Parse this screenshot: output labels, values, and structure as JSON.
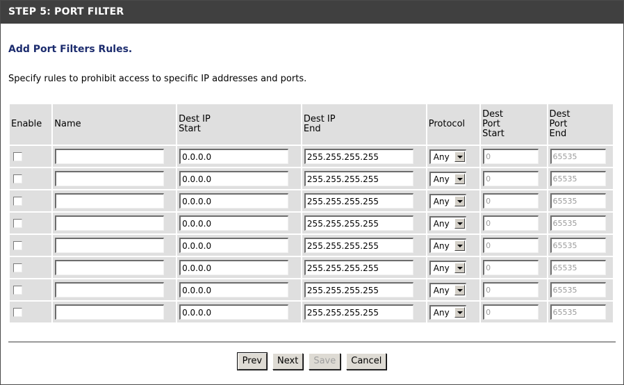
{
  "header": {
    "title": "STEP 5: PORT FILTER"
  },
  "subtitle": "Add Port Filters Rules.",
  "description": "Specify rules to prohibit access to specific IP addresses and ports.",
  "table": {
    "columns": {
      "enable": "Enable",
      "name": "Name",
      "dest_ip_start": [
        "Dest IP",
        "Start"
      ],
      "dest_ip_end": [
        "Dest IP",
        "End"
      ],
      "protocol": "Protocol",
      "dest_port_start": [
        "Dest",
        "Port",
        "Start"
      ],
      "dest_port_end": [
        "Dest",
        "Port",
        "End"
      ]
    },
    "rows": [
      {
        "enabled": false,
        "name": "",
        "ip_start": "0.0.0.0",
        "ip_end": "255.255.255.255",
        "protocol": "Any",
        "port_start": "0",
        "port_end": "65535"
      },
      {
        "enabled": false,
        "name": "",
        "ip_start": "0.0.0.0",
        "ip_end": "255.255.255.255",
        "protocol": "Any",
        "port_start": "0",
        "port_end": "65535"
      },
      {
        "enabled": false,
        "name": "",
        "ip_start": "0.0.0.0",
        "ip_end": "255.255.255.255",
        "protocol": "Any",
        "port_start": "0",
        "port_end": "65535"
      },
      {
        "enabled": false,
        "name": "",
        "ip_start": "0.0.0.0",
        "ip_end": "255.255.255.255",
        "protocol": "Any",
        "port_start": "0",
        "port_end": "65535"
      },
      {
        "enabled": false,
        "name": "",
        "ip_start": "0.0.0.0",
        "ip_end": "255.255.255.255",
        "protocol": "Any",
        "port_start": "0",
        "port_end": "65535"
      },
      {
        "enabled": false,
        "name": "",
        "ip_start": "0.0.0.0",
        "ip_end": "255.255.255.255",
        "protocol": "Any",
        "port_start": "0",
        "port_end": "65535"
      },
      {
        "enabled": false,
        "name": "",
        "ip_start": "0.0.0.0",
        "ip_end": "255.255.255.255",
        "protocol": "Any",
        "port_start": "0",
        "port_end": "65535"
      },
      {
        "enabled": false,
        "name": "",
        "ip_start": "0.0.0.0",
        "ip_end": "255.255.255.255",
        "protocol": "Any",
        "port_start": "0",
        "port_end": "65535"
      }
    ]
  },
  "buttons": {
    "prev": "Prev",
    "next": "Next",
    "save": "Save",
    "cancel": "Cancel"
  },
  "colors": {
    "header_bg": "#404040",
    "subtitle": "#1c2c6e",
    "cell_bg": "#dfdfdf"
  }
}
